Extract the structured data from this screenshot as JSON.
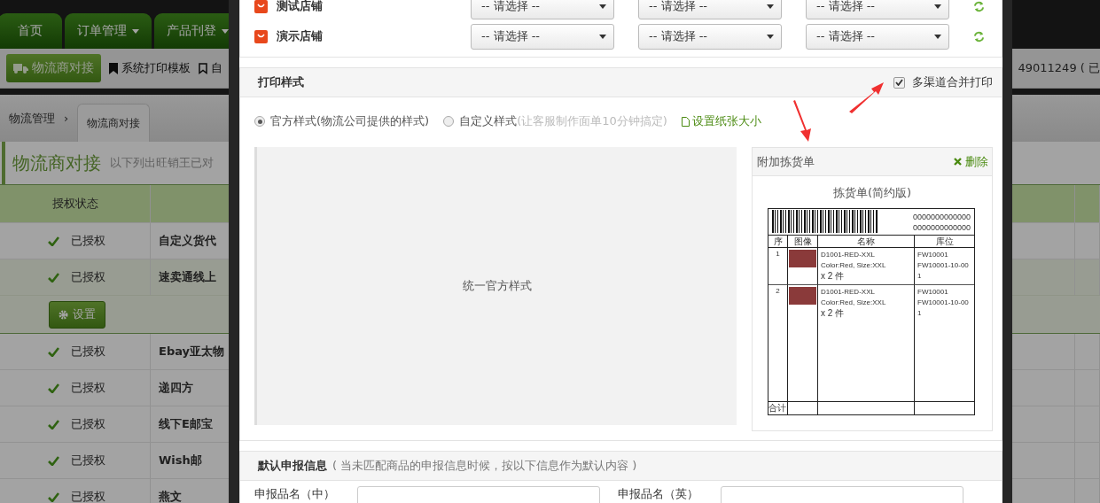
{
  "nav": {
    "tabs": [
      {
        "label": "首页",
        "dropdown": false
      },
      {
        "label": "订单管理",
        "dropdown": true
      },
      {
        "label": "产品刊登",
        "dropdown": true
      }
    ]
  },
  "subnav": {
    "items": [
      {
        "label": "物流商对接",
        "kind": "primary",
        "selected": true
      },
      {
        "label": "系统打印模板",
        "kind": "filled",
        "selected": false
      },
      {
        "label": "自",
        "kind": "outline",
        "selected": false
      }
    ],
    "account": "49011249 ( 已"
  },
  "breadcrumb": {
    "parent": "物流管理",
    "separator": "›",
    "current": "物流商对接"
  },
  "heading": {
    "title": "物流商对接",
    "subtitle": "以下列出旺销王已对"
  },
  "table": {
    "columns": [
      "授权状态"
    ],
    "rows": [
      {
        "status": "已授权",
        "name": "自定义货代",
        "selected": false
      },
      {
        "status": "已授权",
        "name": "速卖通线上",
        "selected": true,
        "action": "设置"
      },
      {
        "status": "已授权",
        "name": "Ebay亚太物",
        "selected": false
      },
      {
        "status": "已授权",
        "name": "递四方",
        "selected": false
      },
      {
        "status": "已授权",
        "name": "线下E邮宝",
        "selected": false
      },
      {
        "status": "已授权",
        "name": "Wish邮",
        "selected": false
      },
      {
        "status": "已授权",
        "name": "燕文",
        "selected": false
      }
    ]
  },
  "dialog": {
    "stores": [
      {
        "name": "测试店铺",
        "selects": [
          "-- 请选择 --",
          "-- 请选择 --",
          "-- 请选择 --"
        ]
      },
      {
        "name": "演示店铺",
        "selects": [
          "-- 请选择 --",
          "-- 请选择 --",
          "-- 请选择 --"
        ]
      }
    ],
    "print_style": {
      "title": "打印样式",
      "merge": {
        "label": "多渠道合并打印",
        "checked": true
      },
      "options": [
        {
          "label": "官方样式(物流公司提供的样式)",
          "selected": true
        },
        {
          "label": "自定义样式",
          "hint": "(让客服制作面单10分钟搞定)",
          "selected": false
        }
      ],
      "paper_link": "设置纸张大小",
      "preview": "统一官方样式",
      "picking": {
        "title": "附加拣货单",
        "delete": "删除",
        "sheet_title": "拣货单(简约版)",
        "barcode_numbers": [
          "0000000000000",
          "0000000000000"
        ],
        "columns": [
          "序",
          "图像",
          "名称",
          "库位"
        ],
        "rows": [
          {
            "index": "1",
            "name_lines": [
              "D1001-RED-XXL",
              "Color:Red, Size:XXL",
              "x 2  件"
            ],
            "locations": [
              "FW10001",
              "FW10001-10-00",
              "1"
            ]
          },
          {
            "index": "2",
            "name_lines": [
              "D1001-RED-XXL",
              "Color:Red, Size:XXL",
              "x 2  件"
            ],
            "locations": [
              "FW10001",
              "FW10001-10-00",
              "1"
            ]
          }
        ],
        "footer": "合计"
      }
    },
    "declaration": {
      "title": "默认申报信息",
      "note": "( 当未匹配商品的申报信息时候，按以下信息作为默认内容 )",
      "fields": [
        {
          "label": "申报品名（中）"
        },
        {
          "label": "申报品名（英）"
        }
      ]
    }
  }
}
